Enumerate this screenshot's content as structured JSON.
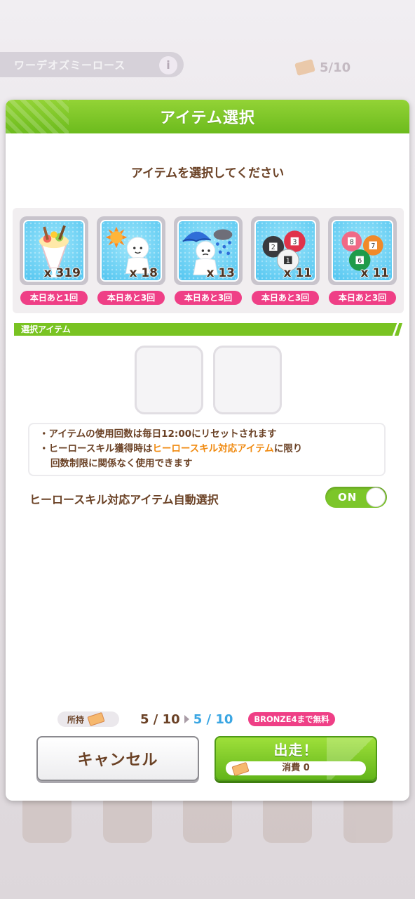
{
  "background": {
    "event_title": "ワーデオズミーロース",
    "info_glyph": "i",
    "counter": "5/10"
  },
  "dialog": {
    "title": "アイテム選択",
    "prompt": "アイテムを選択してください",
    "items": [
      {
        "icon": "parfait-icon",
        "count": "x 319",
        "limit": "本日あと1回"
      },
      {
        "icon": "sunny-doll-icon",
        "count": "x 18",
        "limit": "本日あと3回"
      },
      {
        "icon": "rainy-doll-icon",
        "count": "x 13",
        "limit": "本日あと3回"
      },
      {
        "icon": "lottery-balls-1-2-3-icon",
        "count": "x 11",
        "limit": "本日あと3回"
      },
      {
        "icon": "lottery-balls-6-7-8-icon",
        "count": "x 11",
        "limit": "本日あと3回"
      }
    ],
    "selected_section": "選択アイテム",
    "notes": {
      "line1": "・アイテムの使用回数は毎日12:00にリセットされます",
      "line2_pre": "・ヒーロースキル獲得時は",
      "line2_hl": "ヒーロースキル対応アイテム",
      "line2_post": "に限り",
      "line3": "回数制限に関係なく使用できます"
    },
    "auto_select_label": "ヒーロースキル対応アイテム自動選択",
    "auto_select_state": "ON",
    "owned_label": "所持",
    "current_count": "5 / 10",
    "next_count": "5 / 10",
    "free_badge": "BRONZE4まで無料",
    "cancel_label": "キャンセル",
    "go_label": "出走！",
    "consume_label": "消費 0"
  },
  "colors": {
    "accent_green": "#79c322",
    "badge_pink": "#ef3f86",
    "text_brown": "#6b4226",
    "highlight_orange": "#f08a10",
    "next_blue": "#3aa6e3"
  }
}
